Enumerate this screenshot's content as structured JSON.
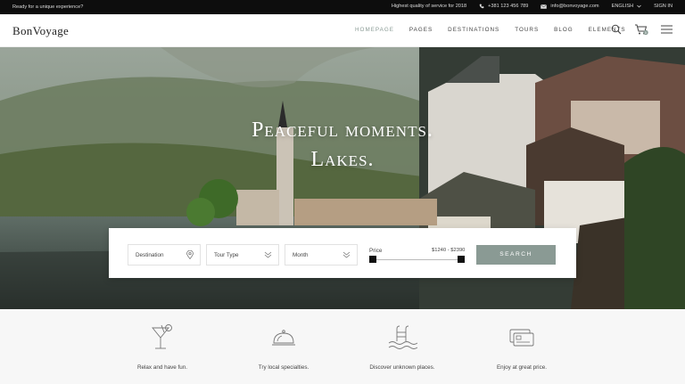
{
  "topbar": {
    "tagline": "Ready for a unique experience?",
    "quality": "Highest quality of service for 2018",
    "phone": "+381 123 456 789",
    "email": "info@bonvoyage.com",
    "language": "ENGLISH",
    "signin": "SIGN IN"
  },
  "header": {
    "logo": "BonVoyage",
    "nav": [
      "HOMEPAGE",
      "PAGES",
      "DESTINATIONS",
      "TOURS",
      "BLOG",
      "ELEMENTS"
    ],
    "active_color": "#8a9b95",
    "cart_count": "0"
  },
  "hero": {
    "title_line1": "Peaceful moments.",
    "title_line2": "Lakes."
  },
  "search": {
    "destination": "Destination",
    "tour_type": "Tour Type",
    "month": "Month",
    "price_label": "Price",
    "price_range": "$1240 - $2390",
    "button": "SEARCH",
    "button_color": "#8a9a94"
  },
  "features": [
    {
      "icon": "cocktail-icon",
      "caption": "Relax and have fun."
    },
    {
      "icon": "dish-cloche-icon",
      "caption": "Try local specialties."
    },
    {
      "icon": "pool-ladder-icon",
      "caption": "Discover unknown places."
    },
    {
      "icon": "credit-card-icon",
      "caption": "Enjoy at great price."
    }
  ]
}
